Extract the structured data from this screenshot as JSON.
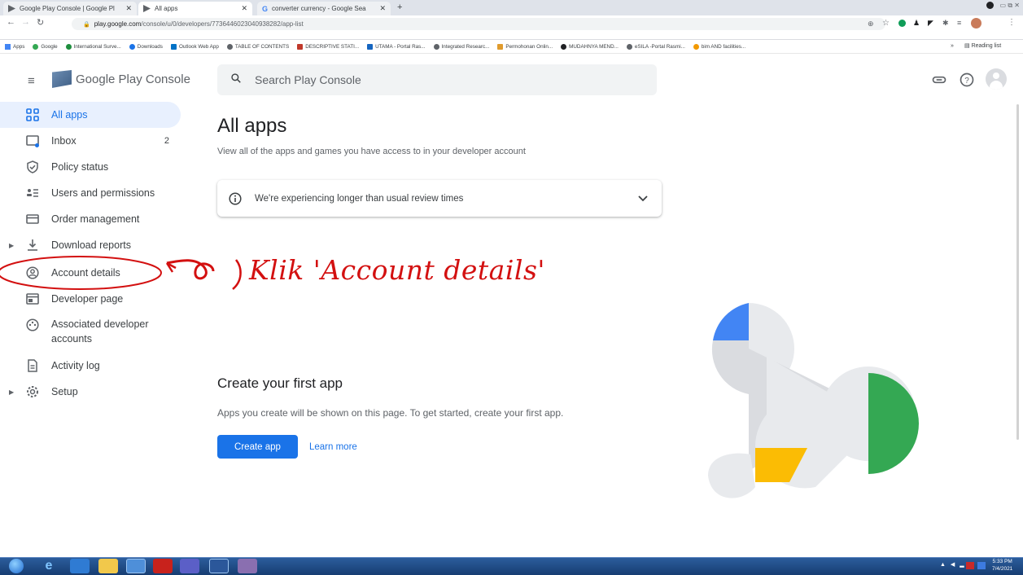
{
  "browser": {
    "tabs": [
      {
        "title": "Google Play Console | Google Pl"
      },
      {
        "title": "All apps"
      },
      {
        "title": "converter currency - Google Sea"
      }
    ],
    "new_tab": "+",
    "url_host": "play.google.com",
    "url_path": "/console/u/0/developers/7736446023040938282/app-list",
    "bookmarks": [
      "Apps",
      "Google",
      "International Surve...",
      "Downloads",
      "Outlook Web App",
      "TABLE OF CONTENTS",
      "DESCRIPTIVE STATI...",
      "UTAMA - Portal Ras...",
      "Integrated Researc...",
      "Permohonan Onlin...",
      "MUDAHNYA MEND...",
      "eSILA -Portal Rasmi...",
      "bim AND facilities..."
    ],
    "bookmarks_more": "»",
    "reading_list": "Reading list"
  },
  "header": {
    "brand": "Google Play Console",
    "search_placeholder": "Search Play Console"
  },
  "sidebar": {
    "items": [
      {
        "label": "All apps",
        "icon": "grid-icon"
      },
      {
        "label": "Inbox",
        "icon": "inbox-icon",
        "count": "2"
      },
      {
        "label": "Policy status",
        "icon": "shield-icon"
      },
      {
        "label": "Users and permissions",
        "icon": "users-icon"
      },
      {
        "label": "Order management",
        "icon": "card-icon"
      },
      {
        "label": "Download reports",
        "icon": "download-icon"
      },
      {
        "label": "Account details",
        "icon": "account-icon"
      },
      {
        "label": "Developer page",
        "icon": "developer-page-icon"
      },
      {
        "label": "Associated developer accounts",
        "icon": "linked-accounts-icon"
      },
      {
        "label": "Activity log",
        "icon": "document-icon"
      },
      {
        "label": "Setup",
        "icon": "gear-icon"
      }
    ]
  },
  "main": {
    "title": "All apps",
    "subtitle": "View all of the apps and games you have access to in your developer account",
    "notice": "We're experiencing longer than usual review times",
    "empty_title": "Create your first app",
    "empty_desc": "Apps you create will be shown on this page. To get started, create your first app.",
    "create_button": "Create app",
    "learn_more": "Learn more"
  },
  "annotation": {
    "text": "Klik 'Account details'",
    "color": "#d31010"
  },
  "taskbar": {
    "time": "5:33 PM",
    "date": "7/4/2021"
  },
  "colors": {
    "accent": "#1a73e8",
    "active_bg": "#e8f0fe"
  }
}
